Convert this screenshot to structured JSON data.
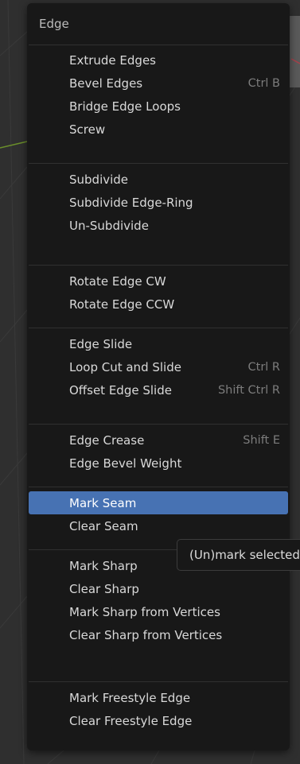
{
  "menu": {
    "title": "Edge",
    "groups": [
      {
        "items": [
          {
            "label": "Extrude Edges",
            "shortcut": ""
          },
          {
            "label": "Bevel Edges",
            "shortcut": "Ctrl B"
          },
          {
            "label": "Bridge Edge Loops",
            "shortcut": ""
          },
          {
            "label": "Screw",
            "shortcut": ""
          }
        ]
      },
      {
        "items": [
          {
            "label": "Subdivide",
            "shortcut": ""
          },
          {
            "label": "Subdivide Edge-Ring",
            "shortcut": ""
          },
          {
            "label": "Un-Subdivide",
            "shortcut": ""
          }
        ]
      },
      {
        "items": [
          {
            "label": "Rotate Edge CW",
            "shortcut": ""
          },
          {
            "label": "Rotate Edge CCW",
            "shortcut": ""
          }
        ]
      },
      {
        "items": [
          {
            "label": "Edge Slide",
            "shortcut": ""
          },
          {
            "label": "Loop Cut and Slide",
            "shortcut": "Ctrl R"
          },
          {
            "label": "Offset Edge Slide",
            "shortcut": "Shift Ctrl R"
          }
        ]
      },
      {
        "items": [
          {
            "label": "Edge Crease",
            "shortcut": "Shift E"
          },
          {
            "label": "Edge Bevel Weight",
            "shortcut": ""
          }
        ]
      },
      {
        "items": [
          {
            "label": "Mark Seam",
            "shortcut": ""
          },
          {
            "label": "Clear Seam",
            "shortcut": ""
          }
        ]
      },
      {
        "items": [
          {
            "label": "Mark Sharp",
            "shortcut": ""
          },
          {
            "label": "Clear Sharp",
            "shortcut": ""
          },
          {
            "label": "Mark Sharp from Vertices",
            "shortcut": ""
          },
          {
            "label": "Clear Sharp from Vertices",
            "shortcut": ""
          }
        ]
      },
      {
        "items": [
          {
            "label": "Mark Freestyle Edge",
            "shortcut": ""
          },
          {
            "label": "Clear Freestyle Edge",
            "shortcut": ""
          }
        ]
      }
    ],
    "active_item": "Mark Seam"
  },
  "tooltip": {
    "text": "(Un)mark selected"
  },
  "colors": {
    "highlight": "#4772b3",
    "menu_bg": "#181818",
    "viewport_bg": "#2f2f2f"
  }
}
